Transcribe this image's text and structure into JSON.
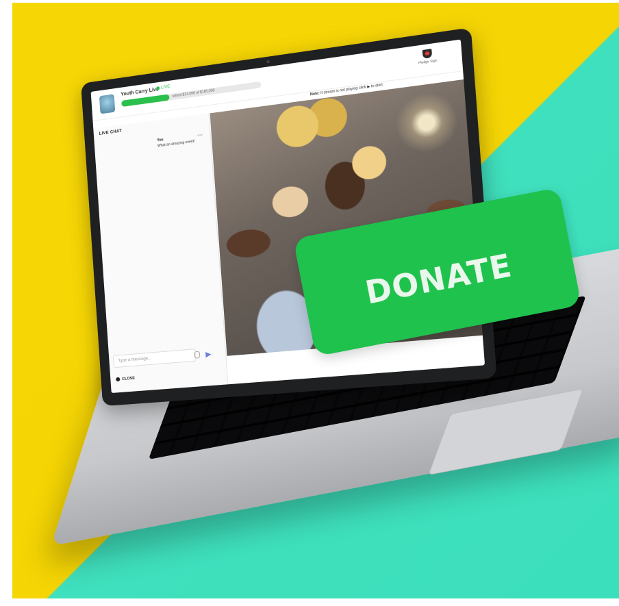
{
  "stream": {
    "org_name": "Youth Carry Live",
    "live_label": "LIVE",
    "progress_fraction": 0.35,
    "progress_text": "raised $13,006 of $185,000",
    "pledge_label": "Pledge Sign"
  },
  "note": {
    "prefix": "Note:",
    "text": "If stream is not playing click ▶ to start"
  },
  "chat": {
    "title": "LIVE CHAT",
    "messages": [
      {
        "author": "You",
        "text": "What an amazing event!",
        "time": "now"
      }
    ],
    "input_placeholder": "Type a message...",
    "close_label": "CLOSE"
  },
  "cta": {
    "donate_label": "DONATE",
    "color": "#1ec24c"
  },
  "colors": {
    "background_yellow": "#f7d605",
    "background_teal": "#3fe0bd",
    "accent_green": "#2bbf4c"
  }
}
